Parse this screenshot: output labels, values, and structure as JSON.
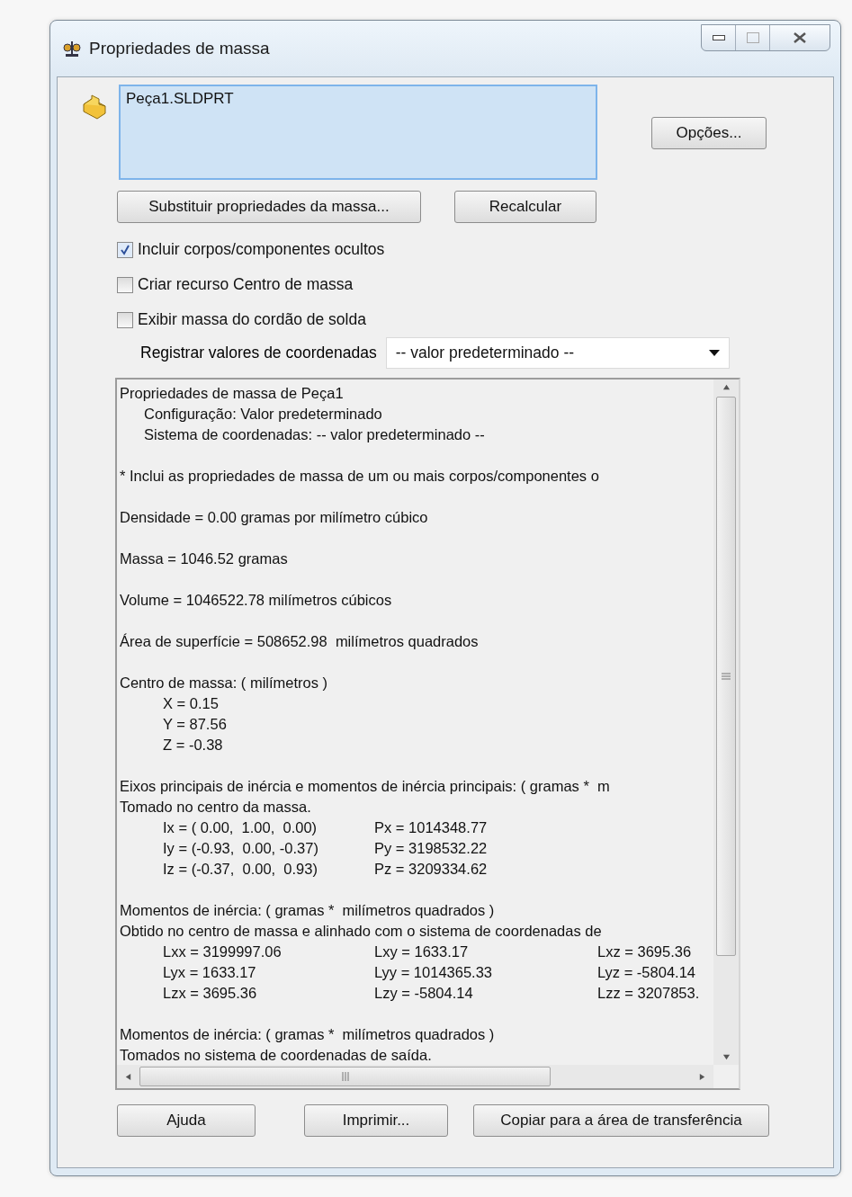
{
  "window": {
    "title": "Propriedades de massa"
  },
  "selection_list": {
    "items": [
      "Peça1.SLDPRT"
    ]
  },
  "options_button": "Opções...",
  "action_buttons": [
    "Substituir propriedades da massa...",
    "Recalcular"
  ],
  "checkboxes": [
    {
      "label": "Incluir corpos/componentes ocultos",
      "checked": true
    },
    {
      "label": "Criar recurso Centro de massa",
      "checked": false
    },
    {
      "label": "Exibir massa do cordão de solda",
      "checked": false
    }
  ],
  "coordinates": {
    "label": "Registrar valores de coordenadas",
    "value": "-- valor predeterminado --"
  },
  "report": [
    {
      "kind": "head",
      "text": "Propriedades de massa de Peça1"
    },
    {
      "kind": "sub",
      "text": "Configuração: Valor predeterminado"
    },
    {
      "kind": "sub",
      "text": "Sistema de coordenadas: -- valor predeterminado --"
    },
    {
      "kind": "gap"
    },
    {
      "kind": "head",
      "text": "* Inclui as propriedades de massa de um ou mais corpos/componentes o"
    },
    {
      "kind": "gap"
    },
    {
      "kind": "head",
      "text": "Densidade = 0.00 gramas por milímetro cúbico"
    },
    {
      "kind": "gap"
    },
    {
      "kind": "head",
      "text": "Massa = 1046.52 gramas"
    },
    {
      "kind": "gap"
    },
    {
      "kind": "head",
      "text": "Volume = 1046522.78 milímetros cúbicos"
    },
    {
      "kind": "gap"
    },
    {
      "kind": "head",
      "text": "Área de superfície = 508652.98  milímetros quadrados"
    },
    {
      "kind": "gap"
    },
    {
      "kind": "head",
      "text": "Centro de massa: ( milímetros )"
    },
    {
      "kind": "value",
      "text": "X = 0.15"
    },
    {
      "kind": "value",
      "text": "Y = 87.56"
    },
    {
      "kind": "value",
      "text": "Z = -0.38"
    },
    {
      "kind": "gap"
    },
    {
      "kind": "head",
      "text": "Eixos principais de inércia e momentos de inércia principais: ( gramas *  m"
    },
    {
      "kind": "head",
      "text": "Tomado no centro da massa."
    },
    {
      "kind": "row",
      "cells": [
        "Ix = ( 0.00,  1.00,  0.00)",
        "Px = 1014348.77"
      ]
    },
    {
      "kind": "row",
      "cells": [
        "Iy = (-0.93,  0.00, -0.37)",
        "Py = 3198532.22"
      ]
    },
    {
      "kind": "row",
      "cells": [
        "Iz = (-0.37,  0.00,  0.93)",
        "Pz = 3209334.62"
      ]
    },
    {
      "kind": "gap"
    },
    {
      "kind": "head",
      "text": "Momentos de inércia: ( gramas *  milímetros quadrados )"
    },
    {
      "kind": "head",
      "text": "Obtido no centro de massa e alinhado com o sistema de coordenadas de"
    },
    {
      "kind": "row",
      "cells": [
        "Lxx = 3199997.06",
        "Lxy = 1633.17",
        "Lxz = 3695.36"
      ]
    },
    {
      "kind": "row",
      "cells": [
        "Lyx = 1633.17",
        "Lyy = 1014365.33",
        "Lyz = -5804.14"
      ]
    },
    {
      "kind": "row",
      "cells": [
        "Lzx = 3695.36",
        "Lzy = -5804.14",
        "Lzz = 3207853."
      ]
    },
    {
      "kind": "gap"
    },
    {
      "kind": "head",
      "text": "Momentos de inércia: ( gramas *  milímetros quadrados )"
    },
    {
      "kind": "head",
      "text": "Tomados no sistema de coordenadas de saída."
    }
  ],
  "footer_buttons": [
    "Ajuda",
    "Imprimir...",
    "Copiar para a área de transferência"
  ]
}
